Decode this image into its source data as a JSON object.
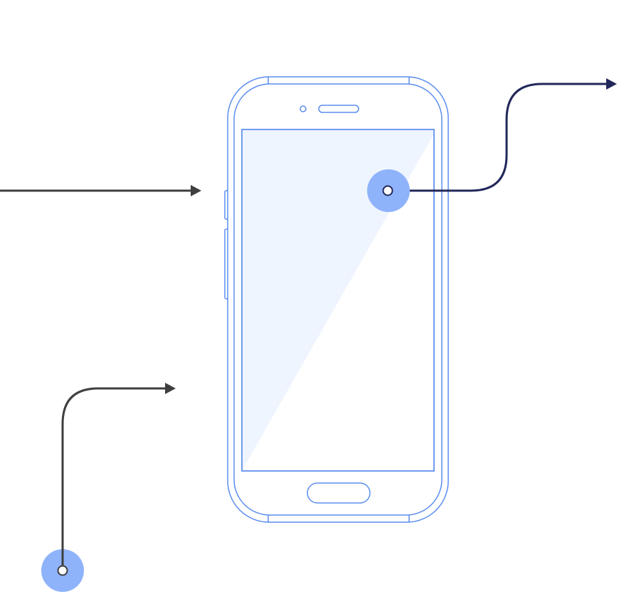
{
  "colors": {
    "device_outline": "#5b8def",
    "screen_fill": "#eff5fe",
    "touch_point": "#8fb3fb",
    "arrow_dark": "#3f3f3f",
    "arrow_navy": "#22275a",
    "background": "#ffffff"
  },
  "device": {
    "type": "smartphone",
    "icon": "smartphone-icon"
  },
  "connectors": [
    {
      "id": "left-arrow",
      "icon": "arrow-right-icon",
      "style": "dark"
    },
    {
      "id": "top-right-arrow",
      "icon": "arrow-right-icon",
      "style": "navy",
      "origin": "screen-touch-point"
    },
    {
      "id": "bottom-left-arrow",
      "icon": "arrow-right-icon",
      "style": "dark",
      "origin": "external-touch-point"
    }
  ]
}
